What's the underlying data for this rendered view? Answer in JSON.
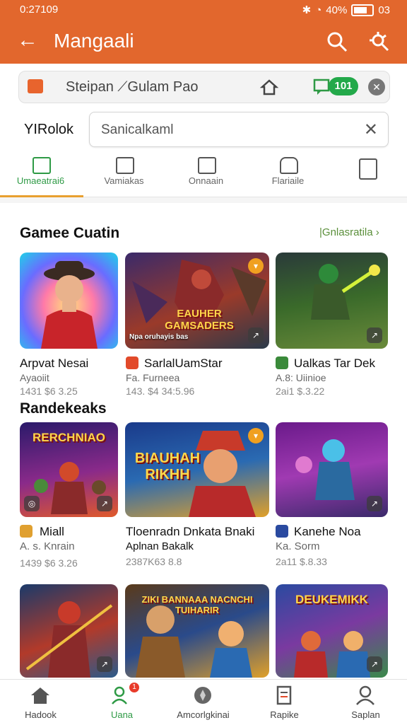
{
  "status_bar": {
    "time": "0:27109",
    "battery": "40%",
    "extra": "03"
  },
  "app_bar": {
    "title": "Mangaali"
  },
  "address_bar": {
    "url": "Steipan ⟋Gulam Pao",
    "pill": "101"
  },
  "filter": {
    "label": "YIRolok",
    "placeholder": "Sanicalkaml"
  },
  "tabs": [
    {
      "label": "Umaeatrai6"
    },
    {
      "label": "Vamiakas"
    },
    {
      "label": "Onnaain"
    },
    {
      "label": "Flariaile"
    },
    {
      "label": ""
    }
  ],
  "section1": {
    "title": "Gamee Cuatin",
    "more": "|Gnlasratila ›"
  },
  "section2": {
    "title": "Randekeaks"
  },
  "games": [
    {
      "name": "Arpvat Nesai",
      "sub": "Ayaoiit",
      "price": "1431 $6 3.25",
      "art_text": ""
    },
    {
      "name": "SarlalUamStar",
      "sub": "Fa. Furneea",
      "price": "143. $4 34:5.96",
      "art_text": "EAUHER GAMSADERS",
      "caption": "Npa oruhayis bas"
    },
    {
      "name": "Ualkas Tar Dek",
      "sub": "A.8: Uiinioe",
      "price": "2ai1 $.3.22",
      "art_text": ""
    },
    {
      "name": "Miall",
      "sub": "A. s. Knrain",
      "price": "1439 $6 3.26",
      "art_text": "RERCHNIAO"
    },
    {
      "name": "Tloenradn Dnkata Bnaki",
      "sub": "Aplnan Bakalk",
      "price": "2387K63 8.8",
      "art_text": "BIAUHAH RIKHH"
    },
    {
      "name": "Kanehe Noa",
      "sub": "Ka. Sorm",
      "price": "2a11 $.8.33",
      "art_text": ""
    },
    {
      "name": "",
      "sub": "",
      "price": "",
      "art_text": ""
    },
    {
      "name": "",
      "sub": "",
      "price": "",
      "art_text": "ZIKI BANNAAA  NACNCHI  TUIHARIR"
    },
    {
      "name": "",
      "sub": "",
      "price": "",
      "art_text": "DEUKEMIKK"
    }
  ],
  "bottom_nav": [
    {
      "label": "Hadook"
    },
    {
      "label": "Uana",
      "badge": "1"
    },
    {
      "label": "Amcorlgkinai"
    },
    {
      "label": "Rapike"
    },
    {
      "label": "Saplan"
    }
  ]
}
